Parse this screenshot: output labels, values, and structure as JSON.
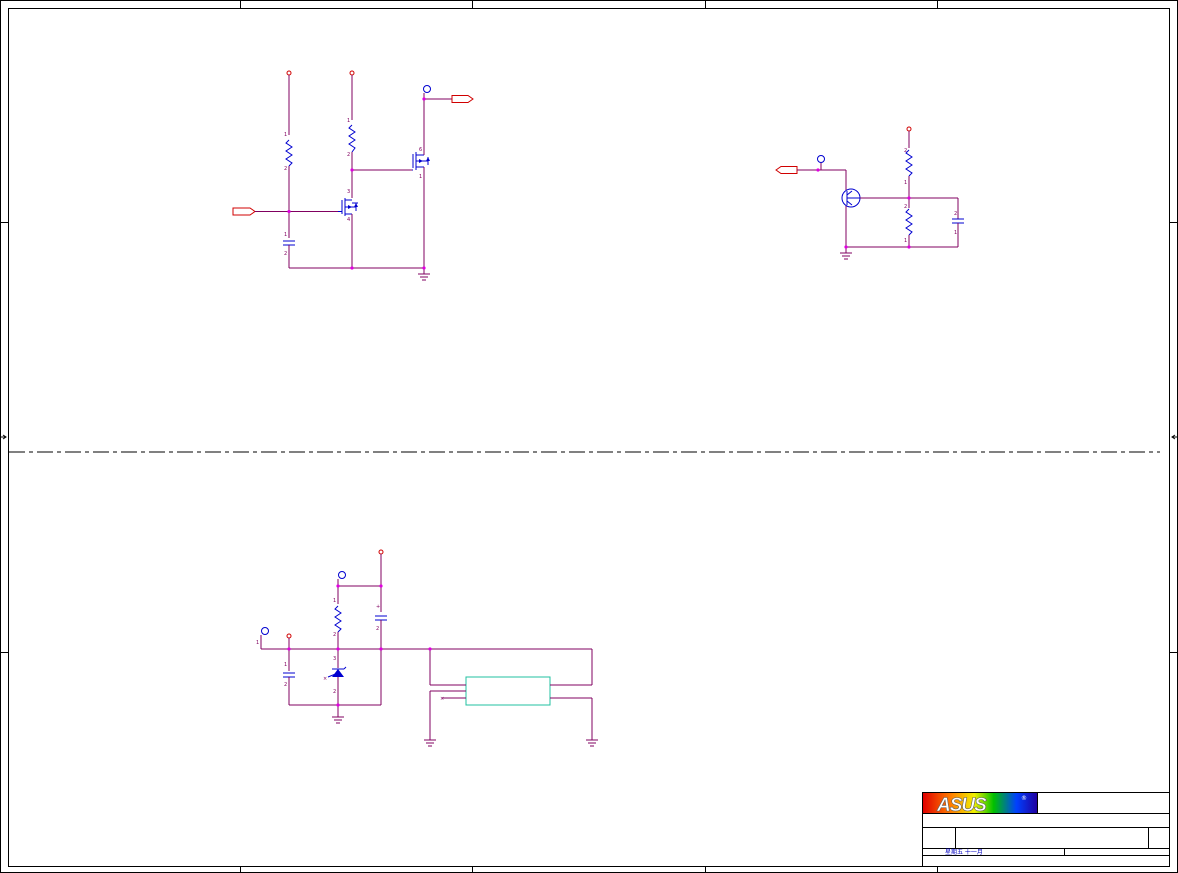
{
  "title_block": {
    "logo_text": "ASUS",
    "registered_mark": "®",
    "date_text": "星期五 十一月"
  },
  "pin_labels": {
    "one": "1",
    "two": "2",
    "three": "3",
    "four": "4",
    "six": "6",
    "no_connect": "×",
    "plus": "+"
  },
  "colors": {
    "wire": "#800060",
    "power": "#d00000",
    "symbol": "#0000d0",
    "junction": "#e000e0",
    "ic_box": "#20c0a0"
  }
}
